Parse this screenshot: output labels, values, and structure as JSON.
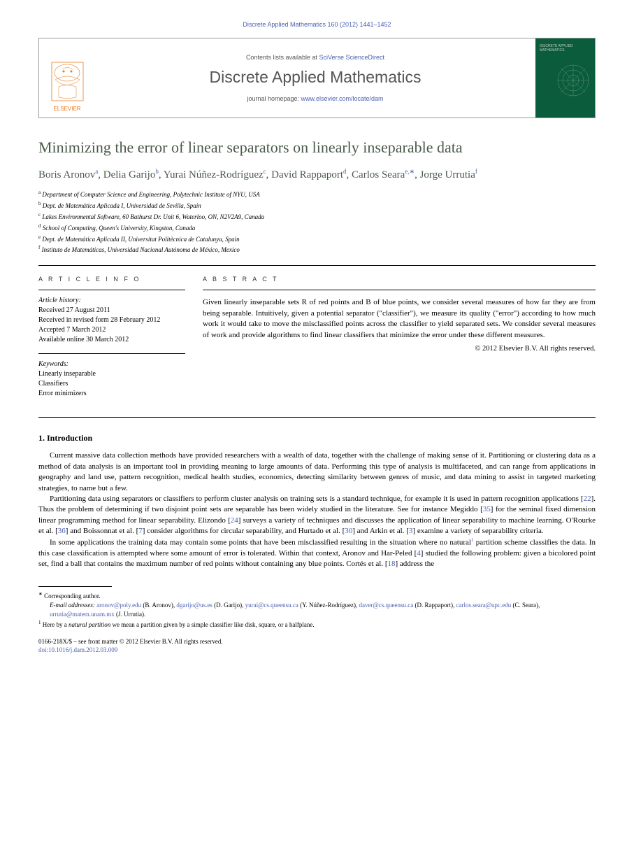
{
  "header": {
    "citation": "Discrete Applied Mathematics 160 (2012) 1441–1452"
  },
  "banner": {
    "contents_prefix": "Contents lists available at ",
    "contents_link": "SciVerse ScienceDirect",
    "journal_name": "Discrete Applied Mathematics",
    "homepage_prefix": "journal homepage: ",
    "homepage_link": "www.elsevier.com/locate/dam",
    "publisher": "ELSEVIER",
    "cover_title": "DISCRETE APPLIED MATHEMATICS"
  },
  "title": "Minimizing the error of linear separators on linearly inseparable data",
  "authors": [
    {
      "name": "Boris Aronov",
      "sup": "a"
    },
    {
      "name": "Delia Garijo",
      "sup": "b"
    },
    {
      "name": "Yurai Núñez-Rodríguez",
      "sup": "c"
    },
    {
      "name": "David Rappaport",
      "sup": "d"
    },
    {
      "name": "Carlos Seara",
      "sup": "e,∗"
    },
    {
      "name": "Jorge Urrutia",
      "sup": "f"
    }
  ],
  "affiliations": [
    {
      "sup": "a",
      "text": "Department of Computer Science and Engineering, Polytechnic Institute of NYU, USA"
    },
    {
      "sup": "b",
      "text": "Dept. de Matemática Aplicada I, Universidad de Sevilla, Spain"
    },
    {
      "sup": "c",
      "text": "Lakes Environmental Software, 60 Bathurst Dr. Unit 6, Waterloo, ON, N2V2A9, Canada"
    },
    {
      "sup": "d",
      "text": "School of Computing, Queen's University, Kingston, Canada"
    },
    {
      "sup": "e",
      "text": "Dept. de Matemàtica Aplicada II, Universitat Politècnica de Catalunya, Spain"
    },
    {
      "sup": "f",
      "text": "Instituto de Matemáticas, Universidad Nacional Autónoma de México, Mexico"
    }
  ],
  "article_info": {
    "label": "A R T I C L E   I N F O",
    "history_label": "Article history:",
    "history": [
      "Received 27 August 2011",
      "Received in revised form 28 February 2012",
      "Accepted 7 March 2012",
      "Available online 30 March 2012"
    ],
    "keywords_label": "Keywords:",
    "keywords": [
      "Linearly inseparable",
      "Classifiers",
      "Error minimizers"
    ]
  },
  "abstract": {
    "label": "A B S T R A C T",
    "text": "Given linearly inseparable sets R of red points and B of blue points, we consider several measures of how far they are from being separable. Intuitively, given a potential separator (\"classifier\"), we measure its quality (\"error\") according to how much work it would take to move the misclassified points across the classifier to yield separated sets. We consider several measures of work and provide algorithms to find linear classifiers that minimize the error under these different measures.",
    "copyright": "© 2012 Elsevier B.V. All rights reserved."
  },
  "body": {
    "heading": "1. Introduction",
    "p1_a": "Current massive data collection methods have provided researchers with a wealth of data, together with the challenge of making sense of it. Partitioning or clustering data as a method of data analysis is an important tool in providing meaning to large amounts of data. Performing this type of analysis is multifaceted, and can range from applications in geography and land use, pattern recognition, medical health studies, economics, detecting similarity between genres of music, and data mining to assist in targeted marketing strategies, to name but a few.",
    "p2_a": "Partitioning data using separators or classifiers to perform cluster analysis on training sets is a standard technique, for example it is used in pattern recognition applications [",
    "ref22": "22",
    "p2_b": "]. Thus the problem of determining if two disjoint point sets are separable has been widely studied in the literature. See for instance Megiddo [",
    "ref35": "35",
    "p2_c": "] for the seminal fixed dimension linear programming method for linear separability. Elizondo [",
    "ref24": "24",
    "p2_d": "] surveys a variety of techniques and discusses the application of linear separability to machine learning. O'Rourke et al. [",
    "ref36": "36",
    "p2_e": "] and Boissonnat et al. [",
    "ref7": "7",
    "p2_f": "] consider algorithms for circular separability, and Hurtado et al. [",
    "ref30": "30",
    "p2_g": "] and Arkin et al. [",
    "ref3": "3",
    "p2_h": "] examine a variety of separability criteria.",
    "p3_a": "In some applications the training data may contain some points that have been misclassified resulting in the situation where no natural",
    "fn1": "1",
    "p3_b": " partition scheme classifies the data. In this case classification is attempted where some amount of error is tolerated. Within that context, Aronov and Har-Peled [",
    "ref4": "4",
    "p3_c": "] studied the following problem: given a bicolored point set, find a ball that contains the maximum number of red points without containing any blue points. Cortés et al. [",
    "ref18": "18",
    "p3_d": "] address the"
  },
  "footnotes": {
    "corr_marker": "∗",
    "corr_text": "Corresponding author.",
    "email_label": "E-mail addresses:",
    "emails": [
      {
        "addr": "aronov@poly.edu",
        "who": " (B. Aronov), "
      },
      {
        "addr": "dgarijo@us.es",
        "who": " (D. Garijo), "
      },
      {
        "addr": "yurai@cs.queensu.ca",
        "who": " (Y. Núñez-Rodríguez), "
      },
      {
        "addr": "daver@cs.queensu.ca",
        "who": " (D. Rappaport), "
      },
      {
        "addr": "carlos.seara@upc.edu",
        "who": " (C. Seara), "
      },
      {
        "addr": "urrutia@matem.unam.mx",
        "who": " (J. Urrutia)."
      }
    ],
    "n1_marker": "1",
    "n1_a": " Here by a ",
    "n1_em": "natural partition",
    "n1_b": " we mean a partition given by a simple classifier like disk, square, or a halfplane."
  },
  "bottom": {
    "issn_line": "0166-218X/$ – see front matter © 2012 Elsevier B.V. All rights reserved.",
    "doi_prefix": "doi:",
    "doi": "10.1016/j.dam.2012.03.009"
  }
}
